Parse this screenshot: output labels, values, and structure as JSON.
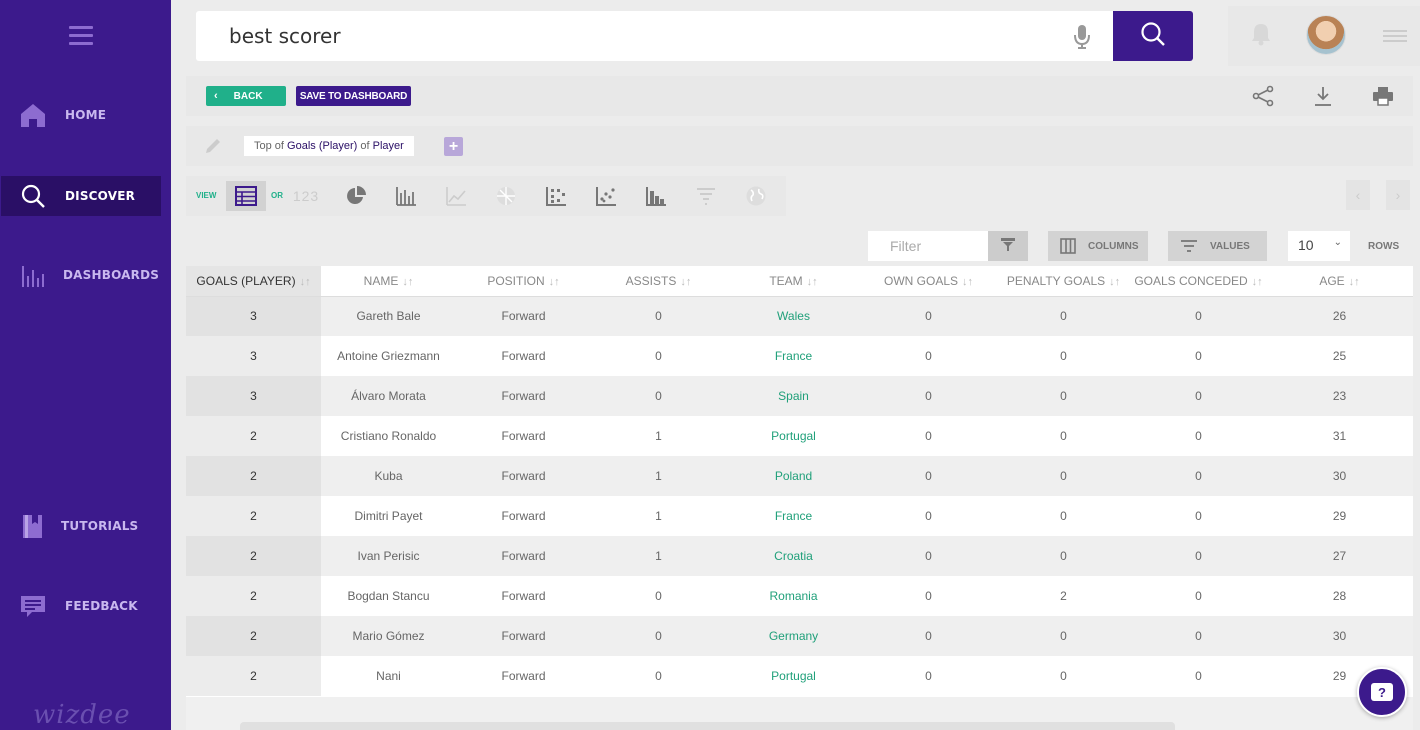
{
  "sidebar": {
    "items": [
      {
        "label": "HOME",
        "icon": "home-icon"
      },
      {
        "label": "DISCOVER",
        "icon": "search-icon"
      },
      {
        "label": "DASHBOARDS",
        "icon": "bar-chart-icon"
      },
      {
        "label": "TUTORIALS",
        "icon": "book-icon"
      },
      {
        "label": "FEEDBACK",
        "icon": "feedback-icon"
      }
    ],
    "logo": "wizdee"
  },
  "search": {
    "query": "best scorer"
  },
  "toolbar": {
    "back_label": "BACK",
    "save_label": "SAVE TO DASHBOARD"
  },
  "query": {
    "prefix": "Top of",
    "measure": "Goals (Player)",
    "mid": "of",
    "dimension": "Player"
  },
  "viewbar": {
    "view_label": "VIEW",
    "or_label": "OR",
    "number_label": "123"
  },
  "controls": {
    "filter_placeholder": "Filter",
    "columns_label": "COLUMNS",
    "values_label": "VALUES",
    "rows_value": "10",
    "rows_label": "ROWS"
  },
  "table": {
    "headers": [
      "GOALS (PLAYER)",
      "NAME",
      "POSITION",
      "ASSISTS",
      "TEAM",
      "OWN GOALS",
      "PENALTY GOALS",
      "GOALS CONCEDED",
      "AGE"
    ],
    "rows": [
      [
        "3",
        "Gareth Bale",
        "Forward",
        "0",
        "Wales",
        "0",
        "0",
        "0",
        "26"
      ],
      [
        "3",
        "Antoine Griezmann",
        "Forward",
        "0",
        "France",
        "0",
        "0",
        "0",
        "25"
      ],
      [
        "3",
        "Álvaro Morata",
        "Forward",
        "0",
        "Spain",
        "0",
        "0",
        "0",
        "23"
      ],
      [
        "2",
        "Cristiano Ronaldo",
        "Forward",
        "1",
        "Portugal",
        "0",
        "0",
        "0",
        "31"
      ],
      [
        "2",
        "Kuba",
        "Forward",
        "1",
        "Poland",
        "0",
        "0",
        "0",
        "30"
      ],
      [
        "2",
        "Dimitri Payet",
        "Forward",
        "1",
        "France",
        "0",
        "0",
        "0",
        "29"
      ],
      [
        "2",
        "Ivan Perisic",
        "Forward",
        "1",
        "Croatia",
        "0",
        "0",
        "0",
        "27"
      ],
      [
        "2",
        "Bogdan Stancu",
        "Forward",
        "0",
        "Romania",
        "0",
        "2",
        "0",
        "28"
      ],
      [
        "2",
        "Mario Gómez",
        "Forward",
        "0",
        "Germany",
        "0",
        "0",
        "0",
        "30"
      ],
      [
        "2",
        "Nani",
        "Forward",
        "0",
        "Portugal",
        "0",
        "0",
        "0",
        "29"
      ]
    ]
  },
  "help": {
    "label": "?"
  },
  "colors": {
    "brand": "#3c1a8c",
    "accent": "#20b08a"
  }
}
